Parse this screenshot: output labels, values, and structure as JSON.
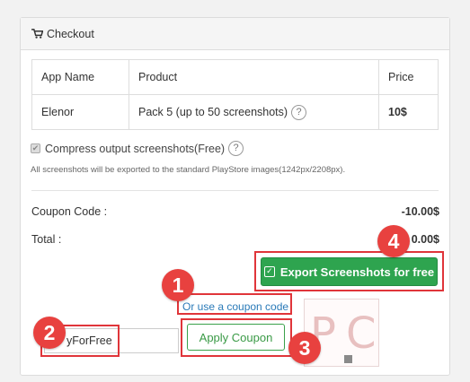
{
  "header": {
    "title": "Checkout",
    "icon": "cart-icon"
  },
  "table": {
    "headers": [
      "App Name",
      "Product",
      "Price"
    ],
    "rows": [
      {
        "app": "Elenor",
        "product": "Pack 5 (up to 50 screenshots)",
        "price": "10$"
      }
    ]
  },
  "compress": {
    "label": "Compress output screenshots(Free)",
    "checked": true
  },
  "note": "All screenshots will be exported to the standard PlayStore images(1242px/2208px).",
  "coupon_row": {
    "label": "Coupon Code :",
    "value": "-10.00$"
  },
  "total_row": {
    "label": "Total :",
    "value": "0.00$"
  },
  "export_button": {
    "label": "Export Screenshots for free"
  },
  "coupon_link": "Or use a coupon code",
  "coupon_input": {
    "value": "yForFree"
  },
  "apply_button": {
    "label": "Apply Coupon"
  },
  "badges": [
    "1",
    "2",
    "3",
    "4"
  ],
  "watermark": {
    "text": "P C"
  },
  "colors": {
    "annotation_red": "#e0353a",
    "success_green": "#2ea44f",
    "link_blue": "#2a7ab8"
  }
}
